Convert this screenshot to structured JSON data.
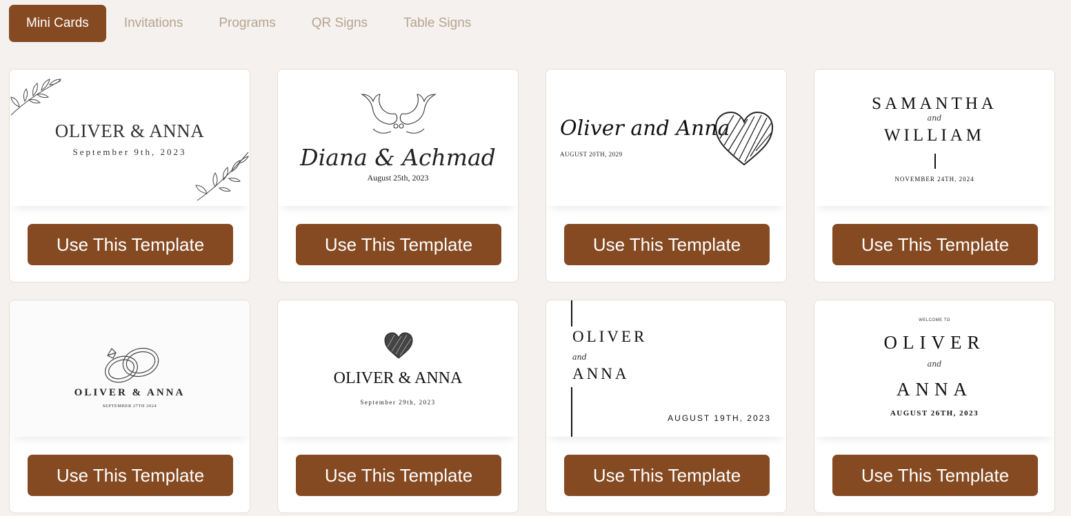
{
  "tabs": [
    {
      "label": "Mini Cards",
      "active": true
    },
    {
      "label": "Invitations",
      "active": false
    },
    {
      "label": "Programs",
      "active": false
    },
    {
      "label": "QR Signs",
      "active": false
    },
    {
      "label": "Table Signs",
      "active": false
    }
  ],
  "button_label": "Use This Template",
  "accent_color": "#854a22",
  "cards": [
    {
      "name": "OLIVER & ANNA",
      "date": "September 9th, 2023",
      "icon": "leaf-branch-icon"
    },
    {
      "name": "Diana & Achmad",
      "date": "August 25th, 2023",
      "icon": "doves-icon"
    },
    {
      "name": "Oliver and Anna",
      "date": "AUGUST 20TH, 2029",
      "icon": "scribble-heart-icon"
    },
    {
      "name_line1": "SAMANTHA",
      "connector": "and",
      "name_line2": "WILLIAM",
      "date": "NOVEMBER 24TH, 2024"
    },
    {
      "name": "OLIVER & ANNA",
      "date": "SEPTEMBER 27TH 2024",
      "icon": "wedding-rings-icon"
    },
    {
      "name": "OLIVER & ANNA",
      "date": "September 29th, 2023",
      "icon": "heart-icon"
    },
    {
      "name_line1": "OLIVER",
      "connector": "and",
      "name_line2": "ANNA",
      "date": "AUGUST 19TH, 2023"
    },
    {
      "welcome": "WELCOME TO",
      "name_line1": "OLIVER",
      "connector": "and",
      "name_line2": "ANNA",
      "date": "AUGUST 26TH, 2023"
    }
  ]
}
